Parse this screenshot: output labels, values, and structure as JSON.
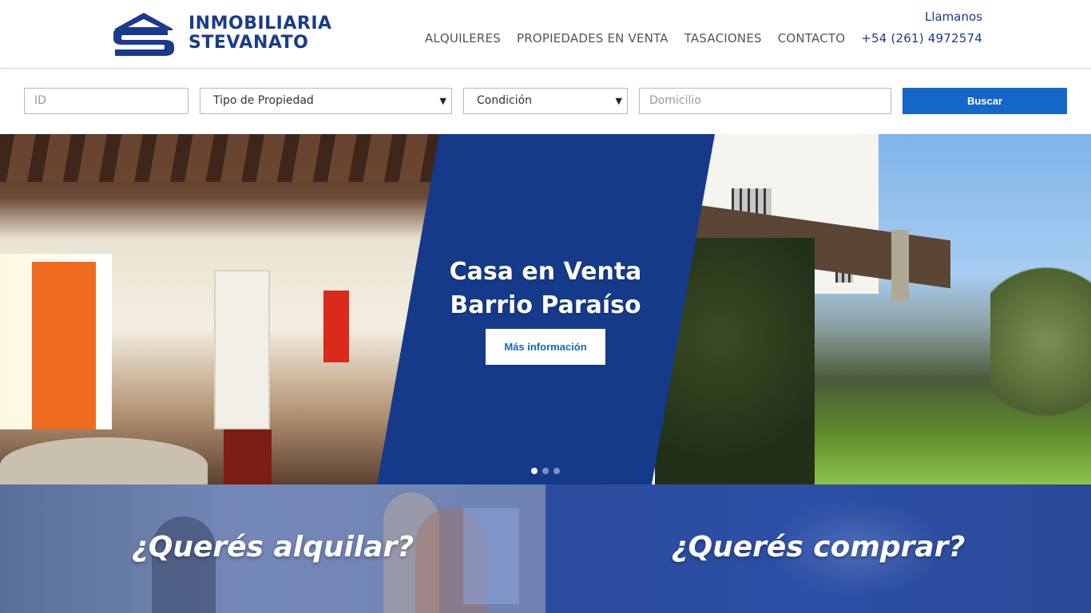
{
  "brand": {
    "line1": "INMOBILIARIA",
    "line2": "STEVANATO",
    "color": "#1a3a8c"
  },
  "nav": {
    "items": [
      {
        "label": "ALQUILERES"
      },
      {
        "label": "PROPIEDADES EN VENTA"
      },
      {
        "label": "TASACIONES"
      },
      {
        "label": "CONTACTO"
      }
    ],
    "call_label": "Llamanos",
    "phone": "+54 (261) 4972574"
  },
  "search": {
    "id_placeholder": "ID",
    "tipo_selected": "Tipo de Propiedad",
    "condicion_selected": "Condición",
    "domicilio_placeholder": "Domicilio",
    "button_label": "Buscar",
    "button_color": "#1466c8"
  },
  "hero": {
    "title_line1": "Casa en Venta",
    "title_line2": "Barrio Paraíso",
    "button_label": "Más información",
    "panel_color": "#163a8a",
    "slides": 3,
    "active_slide": 1
  },
  "panels": {
    "rent_title": "¿Querés alquilar?",
    "buy_title": "¿Querés comprar?"
  }
}
